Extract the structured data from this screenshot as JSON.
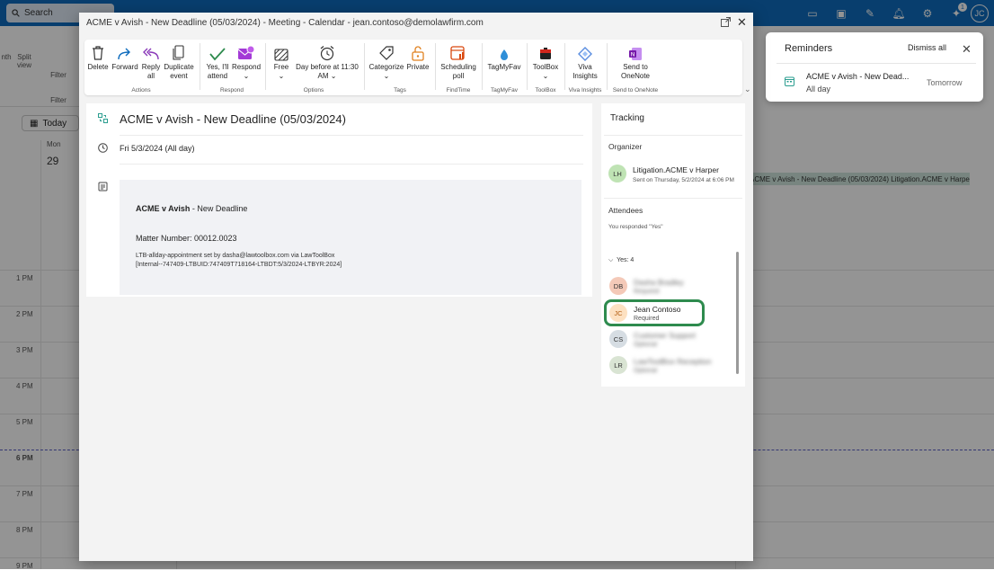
{
  "topbar": {
    "search_placeholder": "Search",
    "icons": [
      "meet-now-icon",
      "word-icon",
      "edit-icon",
      "bell-icon",
      "settings-icon",
      "lightbulb-icon"
    ],
    "tips_badge": "1",
    "user_initials": "JC"
  },
  "base_ribbon": {
    "labels": [
      "nth",
      "Split view",
      "Filter"
    ],
    "group_label": "Filter"
  },
  "calendar": {
    "today_label": "Today",
    "day_name": "Mon",
    "day_number": "29",
    "hours": [
      "1 PM",
      "2 PM",
      "3 PM",
      "4 PM",
      "5 PM",
      "6 PM",
      "7 PM",
      "8 PM",
      "9 PM"
    ],
    "event_bar": {
      "title": "ACME v Avish - New Deadline (05/03/2024)",
      "org": "Litigation.ACME v Harper"
    }
  },
  "reminders": {
    "title": "Reminders",
    "dismiss_all": "Dismiss all",
    "item": {
      "title": "ACME v Avish - New Dead...",
      "subtitle": "All day",
      "when": "Tomorrow"
    }
  },
  "window": {
    "title": "ACME v Avish - New Deadline (05/03/2024) - Meeting - Calendar - jean.contoso@demolawfirm.com"
  },
  "ribbon": {
    "buttons": {
      "delete": "Delete",
      "forward": "Forward",
      "reply_all_1": "Reply",
      "reply_all_2": "all",
      "duplicate_1": "Duplicate",
      "duplicate_2": "event",
      "attend_1": "Yes, I'll",
      "attend_2": "attend",
      "respond": "Respond",
      "free": "Free",
      "reminder_1": "Day before at 11:30",
      "reminder_2": "AM",
      "categorize": "Categorize",
      "private": "Private",
      "scheduling_1": "Scheduling",
      "scheduling_2": "poll",
      "tagmyfav": "TagMyFav",
      "toolbox": "ToolBox",
      "viva_1": "Viva",
      "viva_2": "Insights",
      "onenote_1": "Send to",
      "onenote_2": "OneNote"
    },
    "groups": {
      "actions": "Actions",
      "respond": "Respond",
      "options": "Options",
      "tags": "Tags",
      "findtime": "FindTime",
      "tagmyfav": "TagMyFav",
      "toolbox": "ToolBox",
      "viva": "Viva Insights",
      "onenote": "Send to OneNote"
    }
  },
  "event": {
    "subject": "ACME v Avish - New Deadline (05/03/2024)",
    "date": "Fri 5/3/2024 (All day)",
    "notes": {
      "heading_bold": "ACME v Avish",
      "heading_rest": " - New Deadline",
      "matter": "Matter Number: 00012.0023",
      "ltb_line1": "LTB-allday-appointment set by dasha@lawtoolbox.com via LawToolBox",
      "ltb_line2": "[Internal--747409-LTBUID:747409T718164-LTBDT:5/3/2024-LTBYR:2024]"
    }
  },
  "tracking": {
    "title": "Tracking",
    "organizer_header": "Organizer",
    "organizer": {
      "initials": "LH",
      "name": "Litigation.ACME v Harper",
      "sent": "Sent on Thursday, 5/2/2024 at 6:06 PM"
    },
    "attendees_header": "Attendees",
    "response_note": "You responded \"Yes\"",
    "yes_group": "Yes: 4",
    "attendees": [
      {
        "initials": "DB",
        "name": "Dasha Bradley",
        "role": "Required",
        "blurred": true,
        "color": "#f4c9b8"
      },
      {
        "initials": "JC",
        "name": "Jean Contoso",
        "role": "Required",
        "blurred": false,
        "color": "#fde1c2"
      },
      {
        "initials": "CS",
        "name": "Customer Support",
        "role": "Optional",
        "blurred": true,
        "color": "#d6dde3"
      },
      {
        "initials": "LR",
        "name": "LawToolBox Reception",
        "role": "Optional",
        "blurred": true,
        "color": "#d9e4d3"
      }
    ]
  }
}
